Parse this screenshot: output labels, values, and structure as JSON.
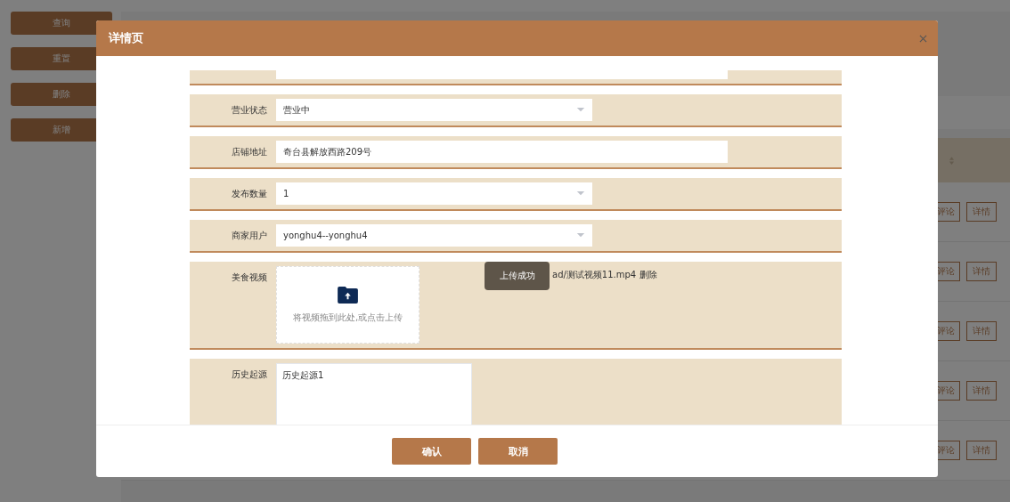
{
  "sidebar_buttons": [
    "查询",
    "重置",
    "删除",
    "新增"
  ],
  "table_rows": [
    {
      "action_1": "评论",
      "action_2": "详情"
    },
    {
      "action_1": "评论",
      "action_2": "详情"
    },
    {
      "action_1": "评论",
      "action_2": "详情"
    },
    {
      "action_1": "评论",
      "action_2": "详情"
    },
    {
      "action_1": "评论",
      "action_2": "详情"
    }
  ],
  "dialog": {
    "title": "详情页",
    "fields": [
      {
        "kind": "partial"
      },
      {
        "kind": "select",
        "label": "营业状态",
        "value": "营业中"
      },
      {
        "kind": "input",
        "label": "店铺地址",
        "value": "奇台县解放西路209号"
      },
      {
        "kind": "select",
        "label": "发布数量",
        "value": "1"
      },
      {
        "kind": "select",
        "label": "商家用户",
        "value": "yonghu4--yonghu4"
      },
      {
        "kind": "upload",
        "label": "美食视频",
        "hint": "将视频拖到此处,或点击上传",
        "file": "ad/测试视频11.mp4",
        "remove": "删除"
      },
      {
        "kind": "textarea",
        "label": "历史起源",
        "value": "历史起源1"
      }
    ],
    "toast": "上传成功",
    "buttons": [
      "确认",
      "取消"
    ]
  }
}
